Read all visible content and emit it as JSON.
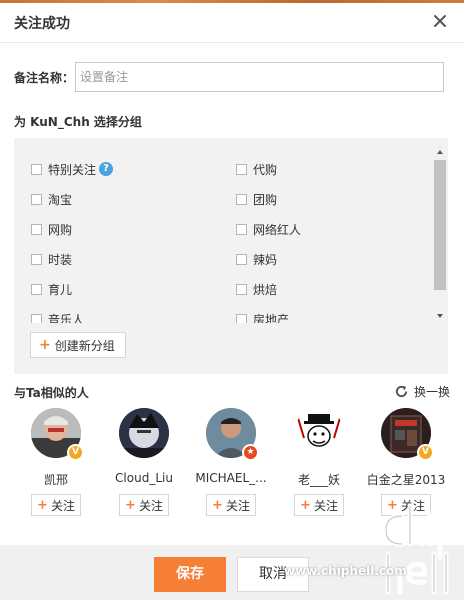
{
  "dialog": {
    "title": "关注成功",
    "close_icon": "close-icon"
  },
  "remark": {
    "label": "备注名称：",
    "placeholder": "设置备注",
    "value": ""
  },
  "group_section": {
    "title": "为 KuN_Chh 选择分组",
    "groups": [
      {
        "label": "特别关注",
        "checked": false,
        "help": "?"
      },
      {
        "label": "代购",
        "checked": false
      },
      {
        "label": "淘宝",
        "checked": false
      },
      {
        "label": "团购",
        "checked": false
      },
      {
        "label": "网购",
        "checked": false
      },
      {
        "label": "网络红人",
        "checked": false
      },
      {
        "label": "时装",
        "checked": false
      },
      {
        "label": "辣妈",
        "checked": false
      },
      {
        "label": "育儿",
        "checked": false
      },
      {
        "label": "烘焙",
        "checked": false
      },
      {
        "label": "音乐人",
        "checked": false
      },
      {
        "label": "房地产",
        "checked": false
      }
    ],
    "new_group_label": "创建新分组"
  },
  "similar_section": {
    "title": "与Ta相似的人",
    "refresh_label": "换一换",
    "people": [
      {
        "name": "凯邢",
        "badge": "V",
        "follow_label": "关注"
      },
      {
        "name": "Cloud_Liu",
        "badge": "",
        "follow_label": "关注"
      },
      {
        "name": "MICHAEL_...",
        "badge": "★",
        "follow_label": "关注"
      },
      {
        "name": "老___妖",
        "badge": "",
        "follow_label": "关注"
      },
      {
        "name": "白金之星2013",
        "badge": "V",
        "follow_label": "关注"
      }
    ]
  },
  "footer": {
    "save_label": "保存",
    "cancel_label": "取消"
  },
  "watermark": {
    "text": "www.chiphell.com",
    "logo_text": "chip hell"
  },
  "colors": {
    "accent": "#f57f34",
    "help": "#4aa3df",
    "badge_v": "#f5a623",
    "badge_red": "#e8471d"
  }
}
